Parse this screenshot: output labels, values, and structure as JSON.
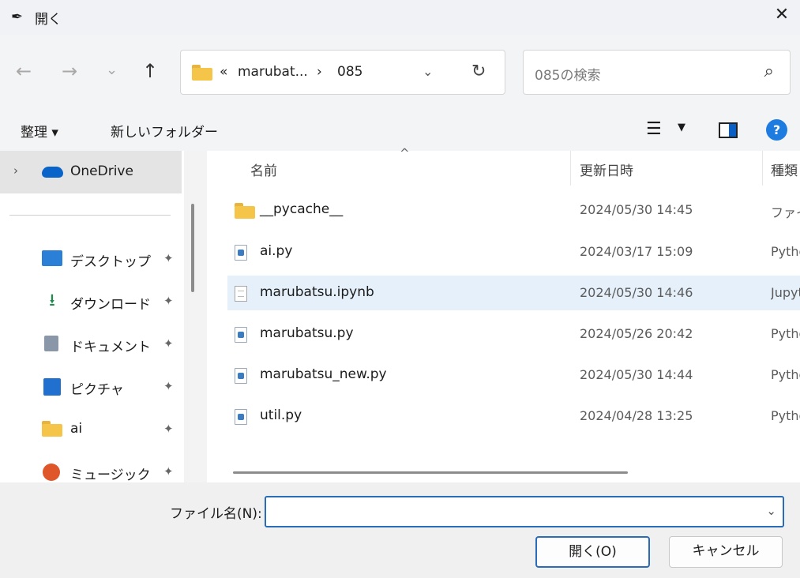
{
  "window": {
    "title": "開く",
    "close_glyph": "✕",
    "app_icon": "feather-icon"
  },
  "nav": {
    "back": "←",
    "forward": "→",
    "recent": "⌄",
    "up": "↑",
    "address": {
      "prefix": "«",
      "crumb1": "marubat...",
      "sep": "›",
      "crumb2": "085",
      "dropdown": "⌄",
      "refresh": "↻"
    },
    "search": {
      "placeholder": "085の検索",
      "icon": "⌕"
    }
  },
  "toolbar": {
    "organize": "整理 ▾",
    "new_folder": "新しいフォルダー",
    "view_icon": "☰",
    "view_dd": "▼",
    "help": "?"
  },
  "sidebar": {
    "onedrive": "OneDrive",
    "chevron": "›",
    "pin": "📌",
    "items": [
      {
        "label": "デスクトップ",
        "icon": "desktop-icon"
      },
      {
        "label": "ダウンロード",
        "icon": "download-icon",
        "glyph": "⭳"
      },
      {
        "label": "ドキュメント",
        "icon": "document-icon"
      },
      {
        "label": "ピクチャ",
        "icon": "picture-icon"
      },
      {
        "label": "ai",
        "icon": "folder-icon"
      },
      {
        "label": "ミュージック",
        "icon": "music-icon"
      }
    ]
  },
  "list": {
    "sort_arrow": "^",
    "columns": {
      "name": "名前",
      "date": "更新日時",
      "type": "種類"
    },
    "rows": [
      {
        "name": "__pycache__",
        "date": "2024/05/30 14:45",
        "type": "ファイル",
        "kind": "folder"
      },
      {
        "name": "ai.py",
        "date": "2024/03/17 15:09",
        "type": "Python",
        "kind": "py"
      },
      {
        "name": "marubatsu.ipynb",
        "date": "2024/05/30 14:46",
        "type": "Jupyter",
        "kind": "nb",
        "selected": true
      },
      {
        "name": "marubatsu.py",
        "date": "2024/05/26 20:42",
        "type": "Python",
        "kind": "py"
      },
      {
        "name": "marubatsu_new.py",
        "date": "2024/05/30 14:44",
        "type": "Python",
        "kind": "py"
      },
      {
        "name": "util.py",
        "date": "2024/04/28 13:25",
        "type": "Python",
        "kind": "py"
      }
    ]
  },
  "footer": {
    "filename_label": "ファイル名(N):",
    "filename_value": "",
    "filename_dd": "⌄",
    "open_button": "開く(O)",
    "cancel_button": "キャンセル"
  },
  "colors": {
    "accent": "#2a6cb8",
    "selection": "#e5f0fb",
    "folder": "#f5c54a"
  }
}
